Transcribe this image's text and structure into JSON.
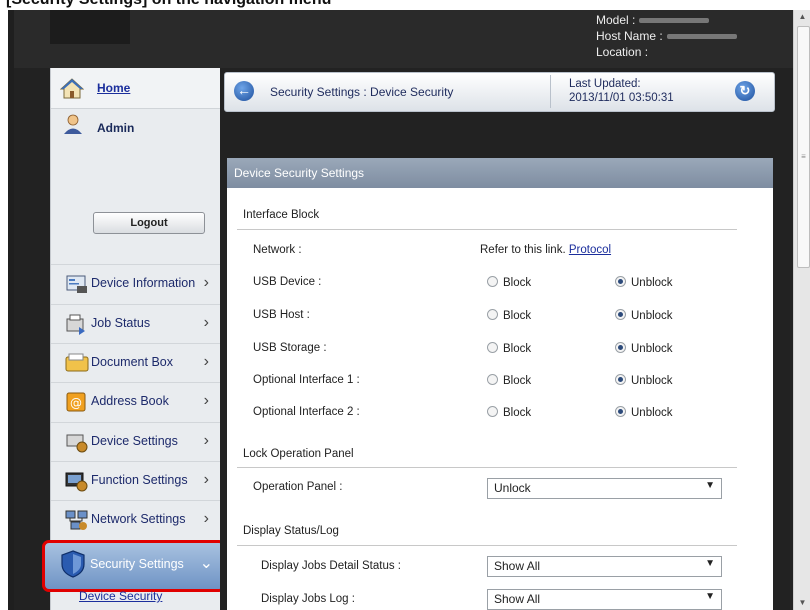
{
  "caption": "[Security Settings] on the navigation menu",
  "header": {
    "model_label": "Model :",
    "host_label": "Host Name :",
    "location_label": "Location :"
  },
  "sidebar": {
    "home": "Home",
    "user": "Admin",
    "logout": "Logout",
    "items": [
      {
        "label": "Device Information",
        "icon": "device-info-icon"
      },
      {
        "label": "Job Status",
        "icon": "job-status-icon"
      },
      {
        "label": "Document Box",
        "icon": "document-box-icon"
      },
      {
        "label": "Address Book",
        "icon": "address-book-icon"
      },
      {
        "label": "Device Settings",
        "icon": "device-settings-icon"
      },
      {
        "label": "Function Settings",
        "icon": "function-settings-icon"
      },
      {
        "label": "Network Settings",
        "icon": "network-settings-icon"
      }
    ],
    "active": {
      "label": "Security Settings",
      "icon": "shield-icon"
    },
    "sub_item": "Device Security"
  },
  "breadcrumb": {
    "text": "Security Settings : Device Security",
    "updated_label": "Last Updated:",
    "updated_value": "2013/11/01 03:50:31"
  },
  "panel": {
    "title": "Device Security Settings",
    "interface_block": {
      "title": "Interface Block",
      "network_label": "Network :",
      "network_text": "Refer to this link.",
      "network_link": "Protocol",
      "block_label": "Block",
      "unblock_label": "Unblock",
      "rows": [
        {
          "label": "USB Device :",
          "value": "Unblock"
        },
        {
          "label": "USB Host :",
          "value": "Unblock"
        },
        {
          "label": "USB Storage :",
          "value": "Unblock"
        },
        {
          "label": "Optional Interface 1 :",
          "value": "Unblock"
        },
        {
          "label": "Optional Interface 2 :",
          "value": "Unblock"
        }
      ]
    },
    "lock_panel": {
      "title": "Lock Operation Panel",
      "label": "Operation Panel :",
      "value": "Unlock"
    },
    "display_status": {
      "title": "Display Status/Log",
      "rows": [
        {
          "label": "Display Jobs Detail Status :",
          "value": "Show All"
        },
        {
          "label": "Display Jobs Log :",
          "value": "Show All"
        }
      ]
    }
  },
  "colors": {
    "highlight_border": "#e00000",
    "link": "#1b2e9c",
    "panel_header": "#8d9bad"
  }
}
